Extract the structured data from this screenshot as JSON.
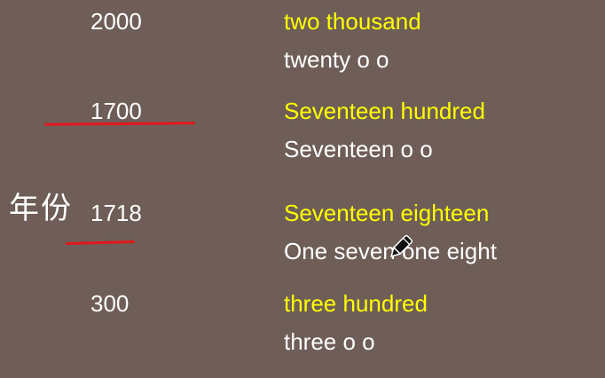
{
  "side_label": "年份",
  "rows": [
    {
      "number": "2000",
      "reading_primary": "two thousand",
      "reading_alt": "twenty o o"
    },
    {
      "number": "1700",
      "reading_primary": "Seventeen hundred",
      "reading_alt": "Seventeen o o"
    },
    {
      "number": "1718",
      "reading_primary": "Seventeen eighteen",
      "reading_alt": "One seven one eight"
    },
    {
      "number": "300",
      "reading_primary": "three hundred",
      "reading_alt": "three o o"
    }
  ],
  "colors": {
    "background": "#6e5e57",
    "primary_reading": "#ffff00",
    "alt_reading": "#ffffff",
    "pen": "#e3171b"
  },
  "icons": {
    "cursor": "pen-cursor-icon"
  }
}
